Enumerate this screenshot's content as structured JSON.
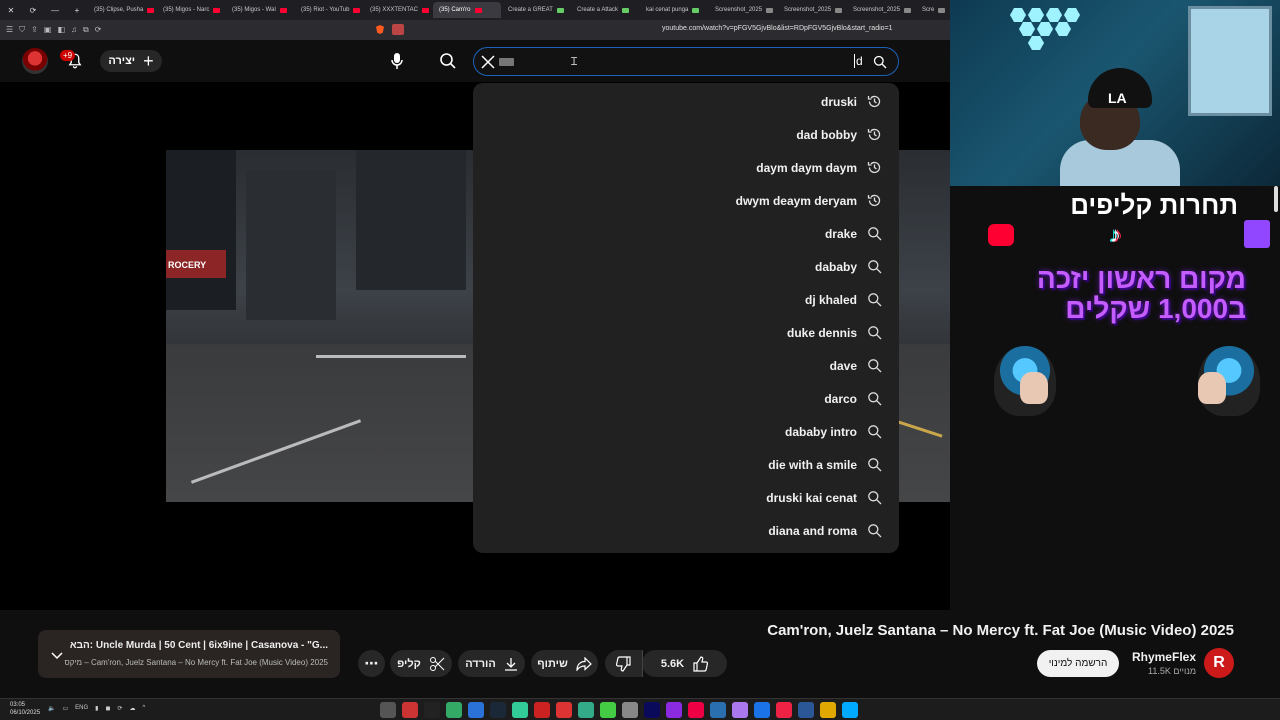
{
  "browser": {
    "tabs": [
      {
        "label": "(35) Clipse, Pusha",
        "icon": "youtube"
      },
      {
        "label": "(35) Migos - Narc",
        "icon": "youtube"
      },
      {
        "label": "(35) Migos - Wal",
        "icon": "youtube"
      },
      {
        "label": "(35) Riot - YouTub",
        "icon": "youtube"
      },
      {
        "label": "(35) XXXTENTAC",
        "icon": "youtube"
      },
      {
        "label": "(35) Cam'ro",
        "icon": "youtube",
        "active": true
      },
      {
        "label": "Create a GREAT",
        "icon": "document"
      },
      {
        "label": "Create a Attack",
        "icon": "document"
      },
      {
        "label": "kai cenat punga",
        "icon": "document"
      },
      {
        "label": "Screenshot_2025",
        "icon": "chrome"
      },
      {
        "label": "Screenshot_2025",
        "icon": "chrome"
      },
      {
        "label": "Screenshot_2025",
        "icon": "chrome"
      },
      {
        "label": "Scre",
        "icon": "chrome"
      }
    ],
    "url": "youtube.com/watch?v=pFGV5GjvBlo&list=RDpFGV5GjvBlo&start_radio=1"
  },
  "header": {
    "notification_count": "+9",
    "create_label": "יצירה",
    "search": {
      "typed": "d"
    }
  },
  "suggestions": [
    {
      "text": "druski",
      "type": "history"
    },
    {
      "text": "dad bobby",
      "type": "history"
    },
    {
      "text": "daym daym daym",
      "type": "history"
    },
    {
      "text": "dwym deaym deryam",
      "type": "history"
    },
    {
      "text": "drake",
      "type": "search"
    },
    {
      "text": "dababy",
      "type": "search"
    },
    {
      "text": "dj khaled",
      "type": "search"
    },
    {
      "text": "duke dennis",
      "type": "search"
    },
    {
      "text": "dave",
      "type": "search"
    },
    {
      "text": "darco",
      "type": "search"
    },
    {
      "text": "dababy intro",
      "type": "search"
    },
    {
      "text": "die with a smile",
      "type": "search"
    },
    {
      "text": "druski kai cenat",
      "type": "search"
    },
    {
      "text": "diana and roma",
      "type": "search"
    }
  ],
  "video_frame": {
    "store_sign": "ROCERY"
  },
  "overlay": {
    "title": "תחרות קליפים",
    "prize_line1": "מקום ראשון יזכה",
    "prize_line2": "ב1,000 שקלים"
  },
  "video": {
    "title": "Cam'ron, Juelz Santana – No Mercy ft. Fat Joe (Music Video) 2025",
    "channel": {
      "name": "RhymeFlex",
      "subs": "11.5K מנויים",
      "avatar_letter": "R"
    },
    "subscribe_label": "הרשמה למינוי",
    "likes": "5.6K",
    "share_label": "שיתוף",
    "download_label": "הורדה",
    "clip_label": "קליפ"
  },
  "up_next": {
    "line1": "הבא: Uncle Murda | 50 Cent | 6ix9ine | Casanova - \"G...",
    "line2": "מיקס – Cam'ron, Juelz Santana – No Mercy ft. Fat Joe (Music Video) 2025"
  },
  "taskbar": {
    "time": "03:05",
    "date": "06/10/2025",
    "lang": "ENG"
  }
}
